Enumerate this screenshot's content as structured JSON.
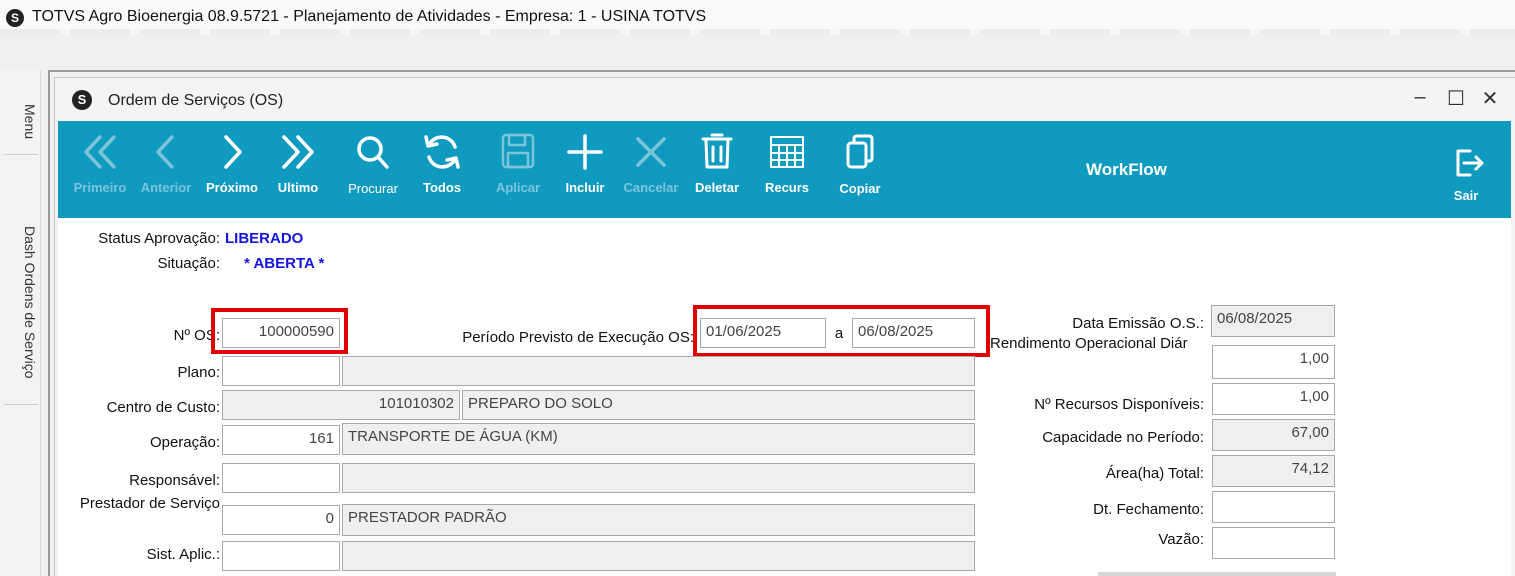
{
  "app": {
    "title": "TOTVS Agro Bioenergia 08.9.5721 - Planejamento de Atividades  - Empresa: 1 - USINA TOTVS"
  },
  "sidebar": {
    "tabs": [
      {
        "label": "Menu"
      },
      {
        "label": "Dash Ordens de Serviço"
      }
    ]
  },
  "window": {
    "title": "Ordem de Serviços (OS)",
    "minimize": "–",
    "maximize": "☐",
    "close": "✕"
  },
  "toolbar": {
    "accent_color": "#0f9ac0",
    "buttons": [
      {
        "label": "Primeiro",
        "icon": "double-chevron-left-icon",
        "enabled": false
      },
      {
        "label": "Anterior",
        "icon": "chevron-left-icon",
        "enabled": false
      },
      {
        "label": "Próximo",
        "icon": "chevron-right-icon",
        "enabled": true
      },
      {
        "label": "Ultimo",
        "icon": "double-chevron-right-icon",
        "enabled": true
      },
      {
        "label": "Procurar",
        "icon": "search-icon",
        "enabled": true
      },
      {
        "label": "Todos",
        "icon": "refresh-icon",
        "enabled": true
      },
      {
        "label": "Aplicar",
        "icon": "save-icon",
        "enabled": false
      },
      {
        "label": "Incluir",
        "icon": "plus-icon",
        "enabled": true
      },
      {
        "label": "Cancelar",
        "icon": "x-icon",
        "enabled": false
      },
      {
        "label": "Deletar",
        "icon": "trash-icon",
        "enabled": true
      },
      {
        "label": "Recurs",
        "icon": "calendar-grid-icon",
        "enabled": true
      },
      {
        "label": "Copiar",
        "icon": "copy-icon",
        "enabled": true
      }
    ],
    "workflow": "WorkFlow",
    "exit": {
      "label": "Sair",
      "icon": "exit-icon"
    }
  },
  "form": {
    "status_aprovacao": {
      "label": "Status Aprovação:",
      "value": "LIBERADO"
    },
    "situacao": {
      "label": "Situação:",
      "value": "* ABERTA *"
    },
    "numero_os": {
      "label": "Nº OS:",
      "value": "100000590"
    },
    "periodo": {
      "label": "Período Previsto de Execução OS:",
      "start": "01/06/2025",
      "separator": "a",
      "end": "06/08/2025"
    },
    "plano": {
      "label": "Plano:",
      "code": "",
      "desc": ""
    },
    "centro_custo": {
      "label": "Centro de Custo:",
      "code": "101010302",
      "desc": "PREPARO DO SOLO"
    },
    "operacao": {
      "label": "Operação:",
      "code": "161",
      "desc": "TRANSPORTE DE ÁGUA (KM)"
    },
    "responsavel": {
      "label": "Responsável:",
      "code": "",
      "desc": ""
    },
    "prestador": {
      "label": "Prestador de Serviço",
      "code": "0",
      "desc": "PRESTADOR PADRÃO"
    },
    "sist_aplic": {
      "label": "Sist. Aplic.:",
      "code": "",
      "desc": ""
    },
    "data_emissao": {
      "label": "Data Emissão O.S.:",
      "value": "06/08/2025"
    },
    "rendimento": {
      "label": "Rendimento Operacional Diár",
      "value": "1,00"
    },
    "recursos": {
      "label": "Nº Recursos Disponíveis:",
      "value": "1,00"
    },
    "capacidade": {
      "label": "Capacidade no Período:",
      "value": "67,00"
    },
    "area_total": {
      "label": "Área(ha) Total:",
      "value": "74,12"
    },
    "dt_fechamento": {
      "label": "Dt. Fechamento:",
      "value": ""
    },
    "vazao": {
      "label": "Vazão:",
      "value": ""
    }
  }
}
